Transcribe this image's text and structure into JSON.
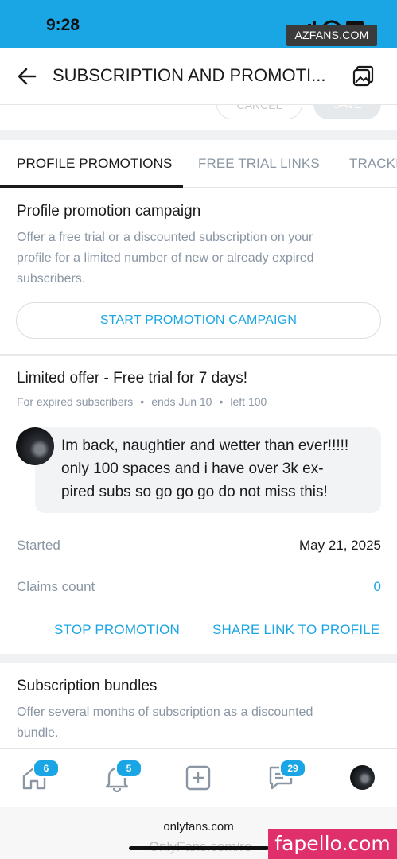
{
  "status_bar": {
    "time": "9:28"
  },
  "watermarks": {
    "top": "AZFANS.COM",
    "bottom": "fapello.com"
  },
  "header": {
    "title": "SUBSCRIPTION AND PROMOTI..."
  },
  "form_buttons": {
    "cancel": "CANCEL",
    "save": "SAVE"
  },
  "tabs": [
    {
      "label": "PROFILE PROMOTIONS",
      "active": true
    },
    {
      "label": "FREE TRIAL LINKS",
      "active": false
    },
    {
      "label": "TRACKI",
      "active": false
    }
  ],
  "campaign": {
    "title": "Profile promotion campaign",
    "description_lines": [
      "Offer a free trial or a discounted subscription on your",
      "profile for a limited number of new or already expired",
      "subscribers."
    ],
    "button": "START PROMOTION CAMPAIGN"
  },
  "offer": {
    "title": "Limited offer - Free trial for 7 days!",
    "audience": "For expired subscribers",
    "ends": "ends Jun 10",
    "left": "left 100",
    "message_lines": [
      "Im back, naughtier and wetter than ever!!!!!",
      "only 100 spaces and i have over 3k ex-",
      "pired subs so go go go do not miss this!"
    ],
    "started_label": "Started",
    "started_value": "May 21, 2025",
    "claims_label": "Claims count",
    "claims_value": "0",
    "stop_button": "STOP PROMOTION",
    "share_button": "SHARE LINK TO PROFILE"
  },
  "bundles": {
    "title": "Subscription bundles",
    "description_lines": [
      "Offer several months of subscription as a discounted",
      "bundle."
    ]
  },
  "bottom_nav": {
    "home_badge": "6",
    "notifications_badge": "5",
    "messages_badge": "29"
  },
  "browser": {
    "domain": "onlyfans.com",
    "url_partial": "OnlyFans.com/re"
  },
  "colors": {
    "accent": "#1aa6e4",
    "muted_text": "#8a96a3",
    "status_bar": "#1aa6e4"
  }
}
